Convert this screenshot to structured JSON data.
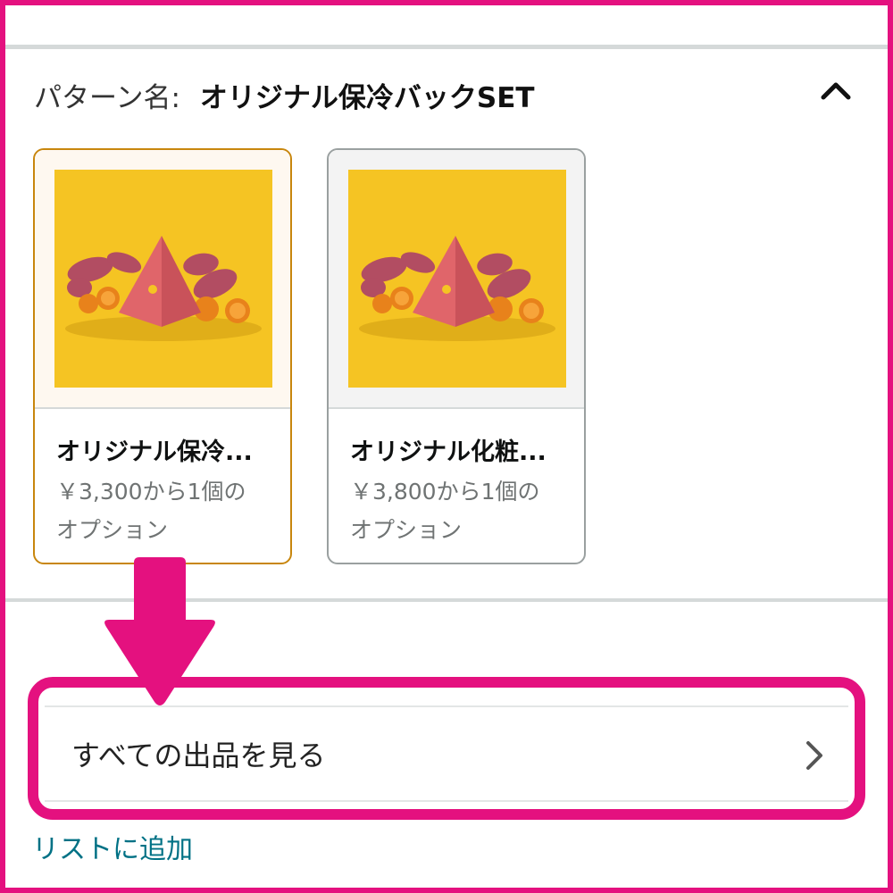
{
  "pattern": {
    "label": "パターン名:",
    "value": "オリジナル保冷バックSET"
  },
  "toggle": {
    "icon": "chevron-up-icon"
  },
  "options": [
    {
      "title": "オリジナル保冷...",
      "price_line": "￥3,300から1個の",
      "option_line": "オプション",
      "selected": true
    },
    {
      "title": "オリジナル化粧...",
      "price_line": "￥3,800から1個の",
      "option_line": "オプション",
      "selected": false
    }
  ],
  "see_all": {
    "label": "すべての出品を見る",
    "icon": "chevron-right-icon"
  },
  "add_to_list": "リストに追加",
  "colors": {
    "highlight": "#e4117f",
    "selected_border": "#c8860d",
    "link": "#007185",
    "product_bg": "#f5c423"
  }
}
